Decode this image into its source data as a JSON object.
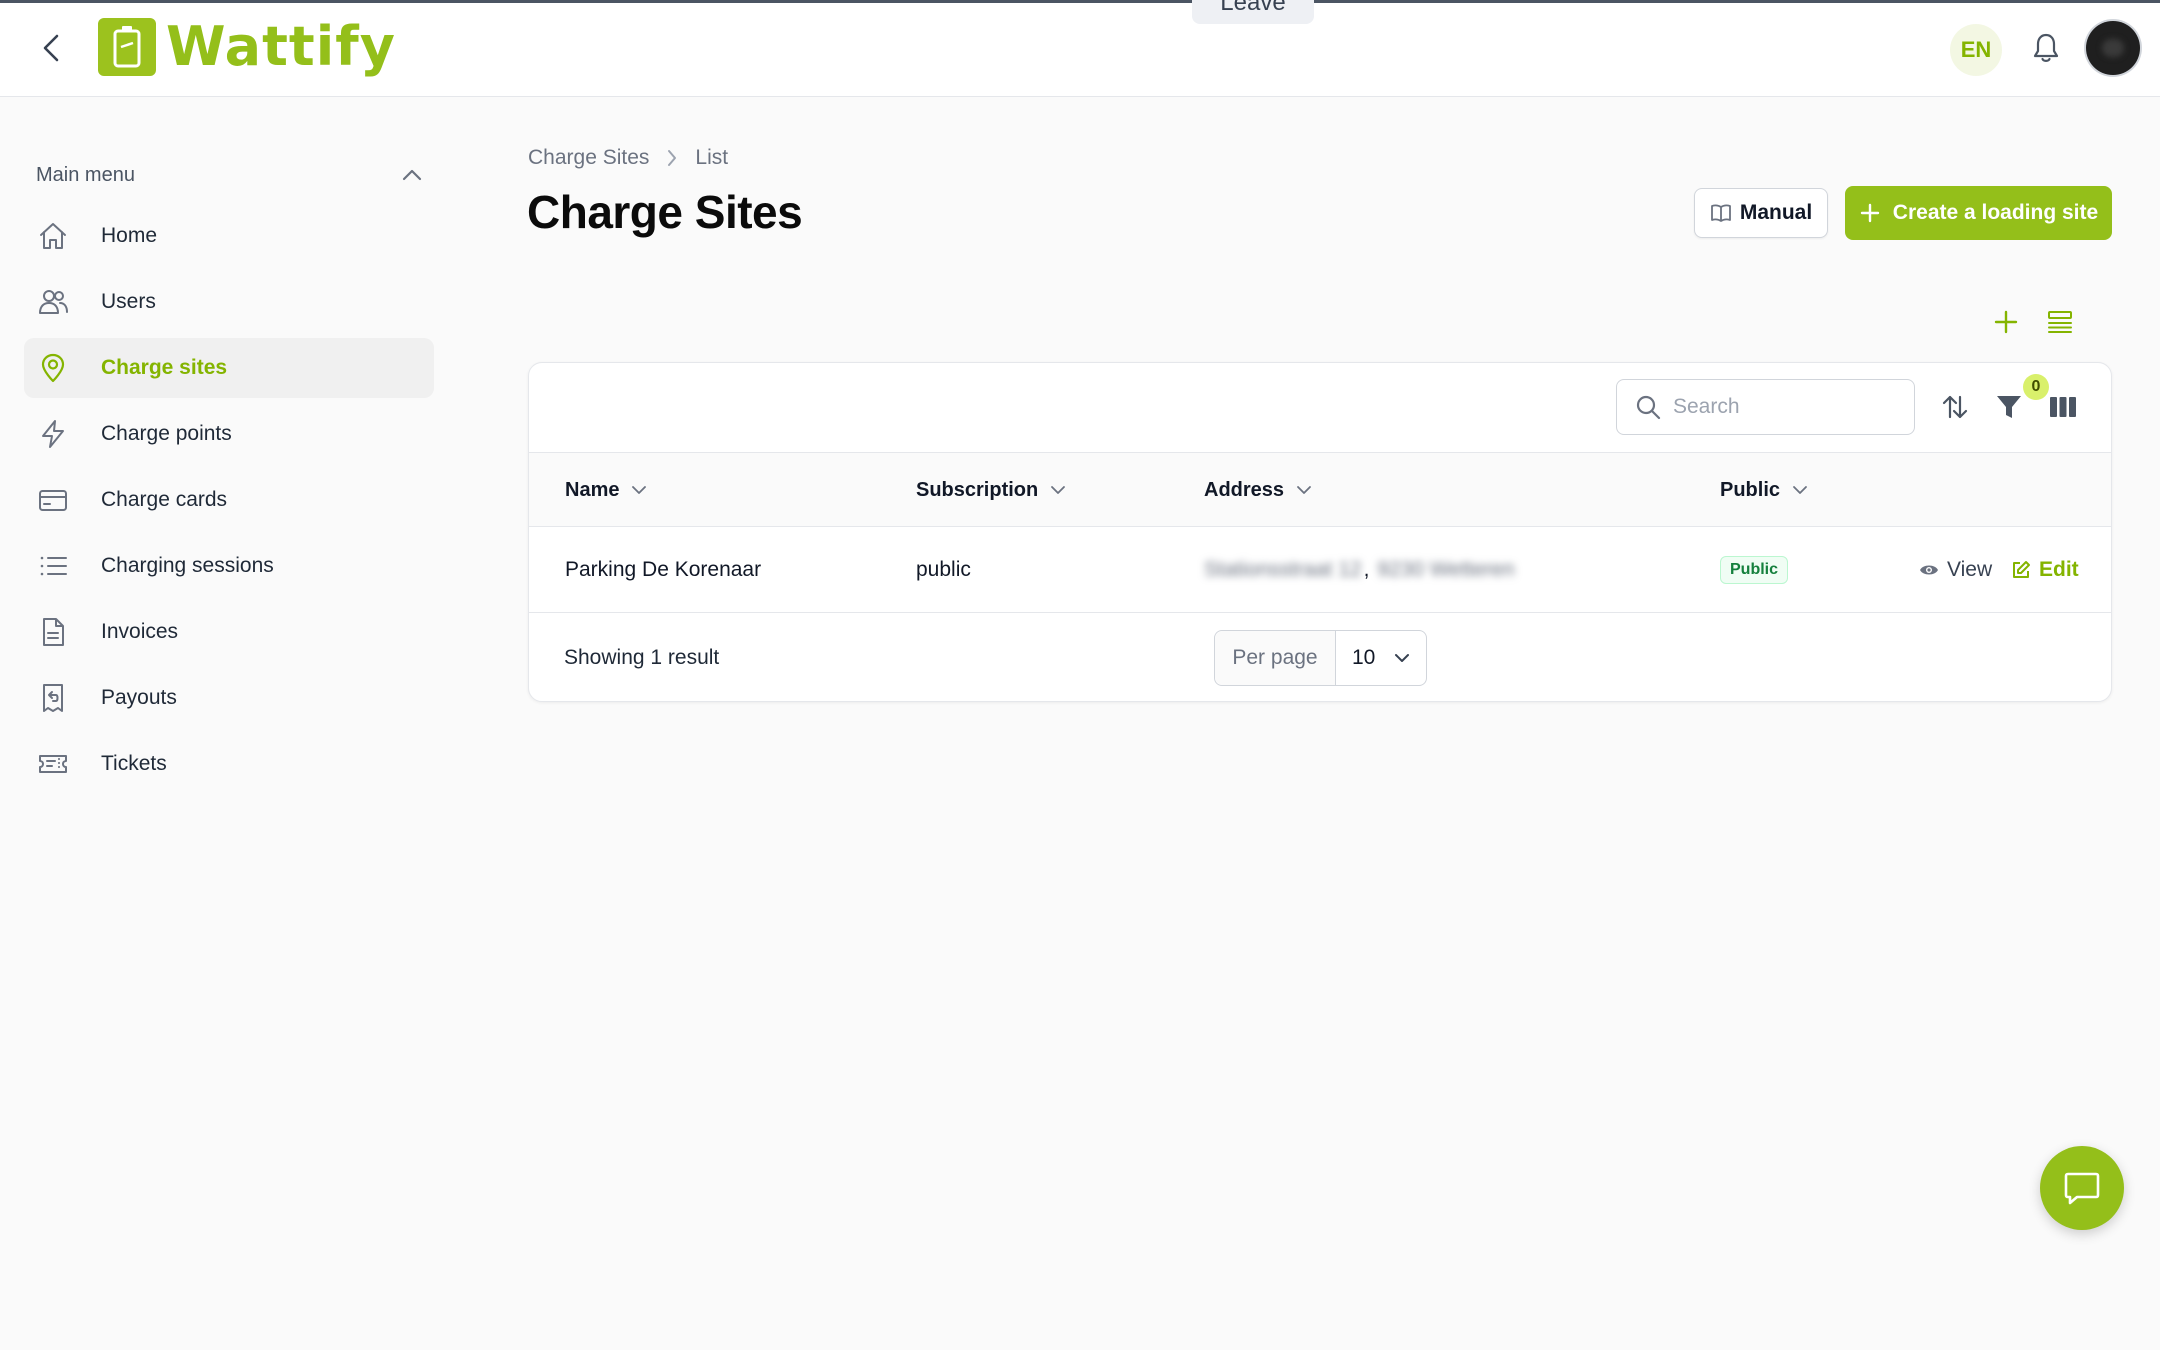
{
  "impersonation": {
    "leave_label": "Leave"
  },
  "brand": {
    "name": "Wattify",
    "accent": "#94bf1a"
  },
  "header": {
    "language": "EN"
  },
  "sidebar": {
    "title": "Main menu",
    "items": [
      {
        "label": "Home",
        "icon": "home-icon",
        "active": false
      },
      {
        "label": "Users",
        "icon": "users-icon",
        "active": false
      },
      {
        "label": "Charge sites",
        "icon": "map-pin-icon",
        "active": true
      },
      {
        "label": "Charge points",
        "icon": "bolt-icon",
        "active": false
      },
      {
        "label": "Charge cards",
        "icon": "credit-card-icon",
        "active": false
      },
      {
        "label": "Charging sessions",
        "icon": "list-icon",
        "active": false
      },
      {
        "label": "Invoices",
        "icon": "document-icon",
        "active": false
      },
      {
        "label": "Payouts",
        "icon": "receipt-refund-icon",
        "active": false
      },
      {
        "label": "Tickets",
        "icon": "ticket-icon",
        "active": false
      }
    ]
  },
  "breadcrumb": {
    "root": "Charge Sites",
    "current": "List"
  },
  "page": {
    "title": "Charge Sites"
  },
  "actions": {
    "manual_label": "Manual",
    "create_label": "Create a loading site"
  },
  "table": {
    "search_placeholder": "Search",
    "filter_count": "0",
    "columns": [
      "Name",
      "Subscription",
      "Address",
      "Public"
    ],
    "rows": [
      {
        "name": "Parking De Korenaar",
        "subscription": "public",
        "address_street": "Stationsstraat 12",
        "address_city": "9230 Wetteren",
        "public": "Public"
      }
    ],
    "row_actions": {
      "view": "View",
      "edit": "Edit"
    },
    "footer": {
      "showing": "Showing 1 result",
      "per_page_label": "Per page",
      "per_page_value": "10"
    }
  }
}
